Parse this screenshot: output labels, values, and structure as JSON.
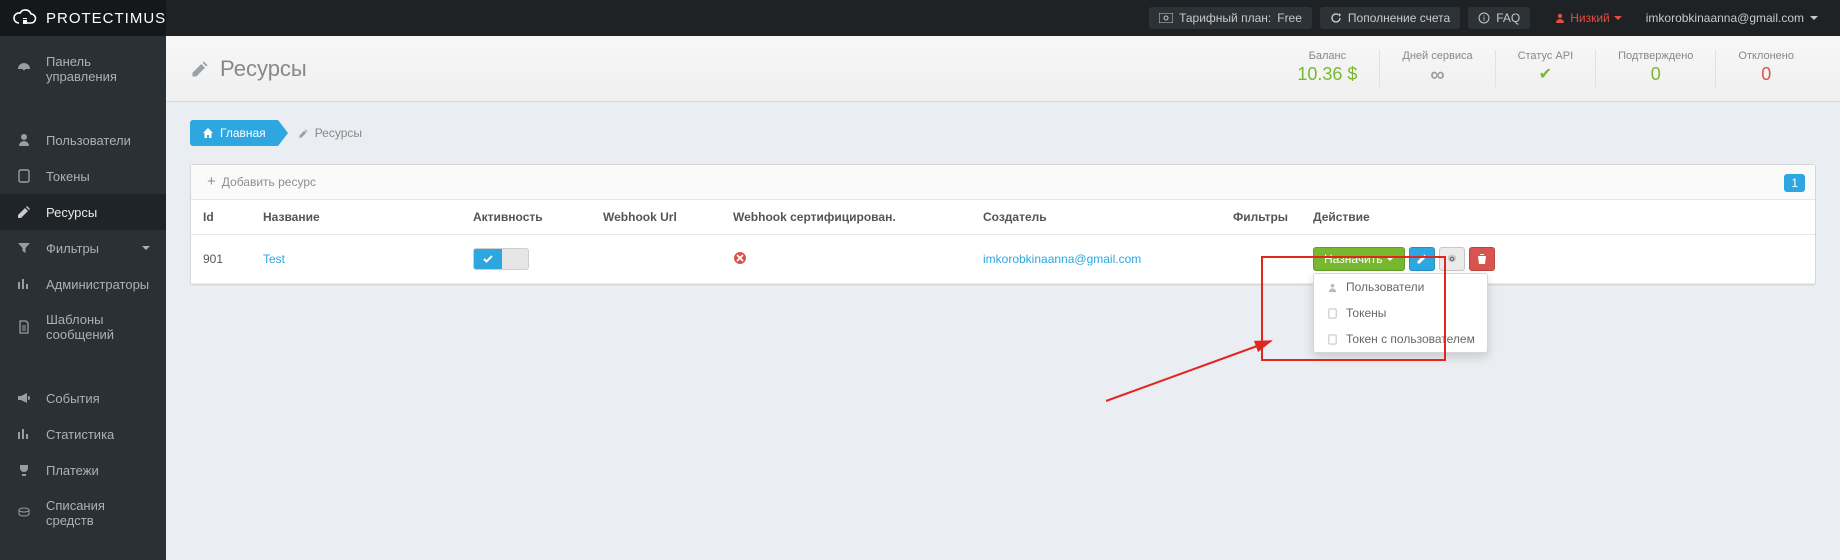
{
  "brand": "Protectimus",
  "topbar": {
    "plan_label": "Тарифный план:",
    "plan_value": "Free",
    "topup": "Пополнение счета",
    "faq": "FAQ",
    "risk": "Низкий",
    "user": "imkorobkinaanna@gmail.com"
  },
  "sidebar": {
    "items": [
      {
        "id": "dashboard",
        "label": "Панель управления"
      },
      {
        "id": "users",
        "label": "Пользователи"
      },
      {
        "id": "tokens",
        "label": "Токены"
      },
      {
        "id": "resources",
        "label": "Ресурсы"
      },
      {
        "id": "filters",
        "label": "Фильтры"
      },
      {
        "id": "admins",
        "label": "Администраторы"
      },
      {
        "id": "templates",
        "label": "Шаблоны сообщений"
      },
      {
        "id": "events",
        "label": "События"
      },
      {
        "id": "stats",
        "label": "Статистика"
      },
      {
        "id": "payments",
        "label": "Платежи"
      },
      {
        "id": "writeoffs",
        "label": "Списания средств"
      }
    ]
  },
  "page": {
    "title": "Ресурсы"
  },
  "stats": {
    "balance_label": "Баланс",
    "balance_value": "10.36 $",
    "days_label": "Дней сервиса",
    "api_label": "Статус API",
    "confirmed_label": "Подтверждено",
    "confirmed_value": "0",
    "rejected_label": "Отклонено",
    "rejected_value": "0"
  },
  "breadcrumb": {
    "home": "Главная",
    "current": "Ресурсы"
  },
  "table": {
    "add_label": "Добавить ресурс",
    "page_num": "1",
    "headers": {
      "id": "Id",
      "name": "Название",
      "active": "Активность",
      "webhook": "Webhook Url",
      "webhook_cert": "Webhook сертифицирован.",
      "creator": "Создатель",
      "filters": "Фильтры",
      "action": "Действие"
    },
    "rows": [
      {
        "id": "901",
        "name": "Test",
        "creator": "imkorobkinaanna@gmail.com"
      }
    ],
    "assign_btn": "Назначить",
    "dropdown": {
      "users": "Пользователи",
      "tokens": "Токены",
      "token_user": "Токен с пользователем"
    }
  }
}
